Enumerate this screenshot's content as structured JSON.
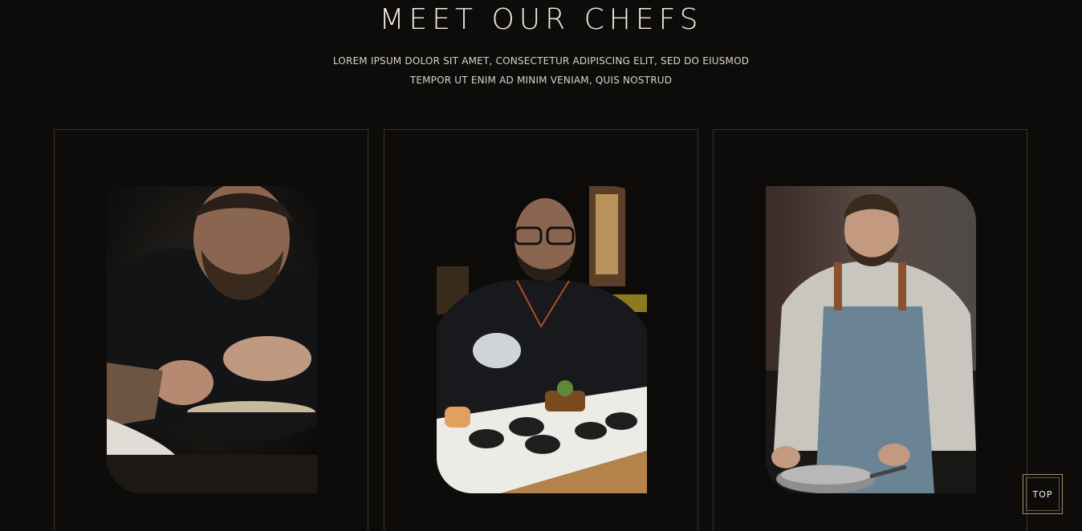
{
  "section": {
    "title": "MEET OUR CHEFS",
    "subtitle_line1": "LOREM IPSUM DOLOR SIT AMET, CONSECTETUR ADIPISCING ELIT, SED DO EIUSMOD",
    "subtitle_line2": "TEMPOR UT ENIM AD MINIM VENIAM, QUIS NOSTRUD"
  },
  "chefs": [
    {
      "photo": "chef-plating-bowl-photo"
    },
    {
      "photo": "chef-garnishing-sushi-photo"
    },
    {
      "photo": "chef-cooking-pan-photo"
    }
  ],
  "scroll_top": {
    "label": "TOP"
  },
  "colors": {
    "background": "#0e0c0a",
    "card_border": "#3d3328",
    "accent": "#a88c6c",
    "text": "#f2ede6"
  }
}
